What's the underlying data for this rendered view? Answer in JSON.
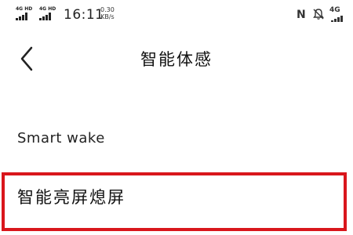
{
  "status_bar": {
    "sim1_network": "4G HD",
    "sim2_network": "4G HD",
    "time": "16:11",
    "speed_value": "0.30",
    "speed_unit": "KB/s",
    "nfc_label": "N",
    "right_network": "4G",
    "icons": [
      "nfc-icon",
      "mute-icon",
      "signal-icon"
    ]
  },
  "header": {
    "back_icon": "chevron-left-icon",
    "title": "智能体感"
  },
  "items": [
    {
      "label": "Smart wake"
    },
    {
      "label": "智能亮屏熄屏"
    }
  ],
  "colors": {
    "highlight_border": "#d9161c",
    "text": "#111111",
    "background": "#ffffff"
  }
}
